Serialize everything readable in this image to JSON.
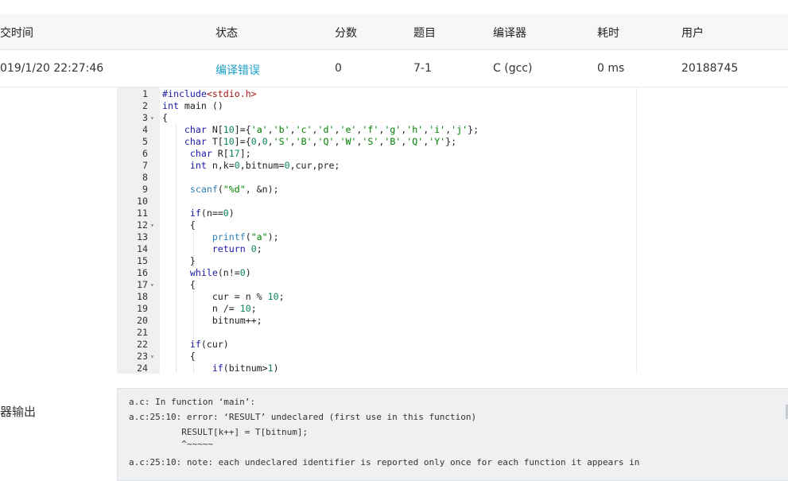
{
  "table": {
    "headers": [
      "交时间",
      "状态",
      "分数",
      "题目",
      "编译器",
      "耗时",
      "用户"
    ],
    "row": {
      "submit_time": "019/1/20 22:27:46",
      "status": "编译错误",
      "score": "0",
      "problem": "7-1",
      "compiler": "C (gcc)",
      "time": "0 ms",
      "user": "20188745"
    }
  },
  "code": {
    "line_numbers": [
      "1",
      "2",
      "3",
      "4",
      "5",
      "6",
      "7",
      "8",
      "9",
      "10",
      "11",
      "12",
      "13",
      "14",
      "15",
      "16",
      "17",
      "18",
      "19",
      "20",
      "21",
      "22",
      "23",
      "24"
    ],
    "lines": [
      "#include<stdio.h>",
      "int main ()",
      "{",
      "    char N[10]={'a','b','c','d','e','f','g','h','i','j'};",
      "    char T[10]={0,0,'S','B','Q','W','S','B','Q','Y'};",
      "     char R[17];",
      "     int n,k=0,bitnum=0,cur,pre;",
      "",
      "     scanf(\"%d\", &n);",
      "",
      "     if(n==0)",
      "     {",
      "         printf(\"a\");",
      "         return 0;",
      "     }",
      "     while(n!=0)",
      "     {",
      "         cur = n % 10;",
      "         n /= 10;",
      "         bitnum++;",
      "",
      "     if(cur)",
      "     {",
      "         if(bitnum>1)"
    ]
  },
  "compiler_output": {
    "label": "器输出",
    "lines": [
      "a.c: In function ‘main’:",
      "a.c:25:10: error: ‘RESULT’ undeclared (first use in this function)",
      "          RESULT[k++] = T[bitnum];",
      "          ^~~~~~",
      "a.c:25:10: note: each undeclared identifier is reported only once for each function it appears in"
    ]
  },
  "colors": {
    "status_link": "#1aa0c8",
    "header_bg": "#f6f7f8",
    "output_bg": "#eef0f2",
    "gutter_bg": "#f0f0f0"
  }
}
